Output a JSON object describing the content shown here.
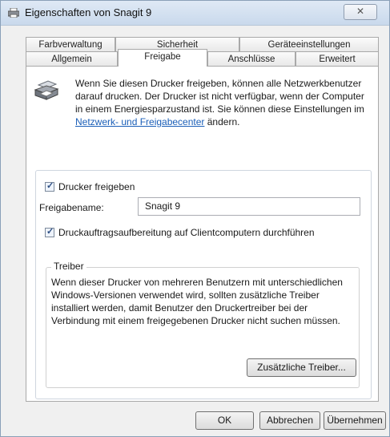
{
  "window": {
    "title": "Eigenschaften von Snagit 9",
    "close_glyph": "✕"
  },
  "tabs": {
    "row1": [
      "Farbverwaltung",
      "Sicherheit",
      "Geräteeinstellungen"
    ],
    "row2": [
      "Allgemein",
      "Freigabe",
      "Anschlüsse",
      "Erweitert"
    ],
    "active": "Freigabe"
  },
  "info": {
    "text": "Wenn Sie diesen Drucker freigeben, können alle Netzwerkbenutzer darauf drucken. Der Drucker ist nicht verfügbar, wenn der Computer in einem Energiesparzustand ist. Sie können diese Einstellungen im ",
    "link": "Netzwerk- und Freigabecenter",
    "suffix": " ändern.",
    "icon": "printer-icon"
  },
  "share": {
    "checkbox_label": "Drucker freigeben",
    "checked": true,
    "name_label": "Freigabename:",
    "name_value": "Snagit 9",
    "render_label": "Druckauftragsaufbereitung auf Clientcomputern durchführen",
    "render_checked": true
  },
  "drivers": {
    "legend": "Treiber",
    "text": "Wenn dieser Drucker von mehreren Benutzern mit unterschiedlichen Windows-Versionen verwendet wird, sollten zusätzliche Treiber installiert werden, damit Benutzer den Druckertreiber bei der Verbindung mit einem freigegebenen Drucker nicht suchen müssen.",
    "button": "Zusätzliche Treiber..."
  },
  "footer": {
    "ok": "OK",
    "cancel": "Abbrechen",
    "apply": "Übernehmen"
  }
}
